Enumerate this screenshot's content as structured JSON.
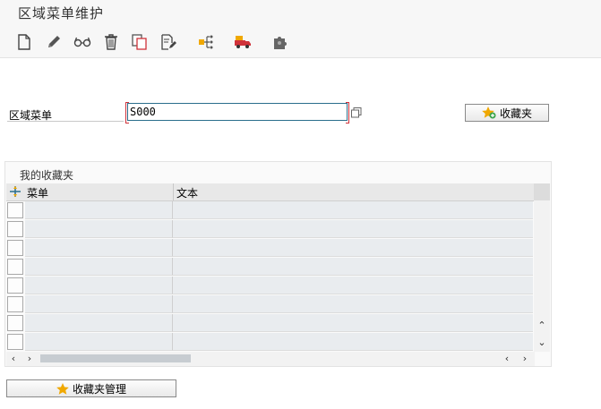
{
  "window": {
    "title": "区域菜单维护"
  },
  "toolbar": {
    "buttons": [
      {
        "name": "new-icon"
      },
      {
        "name": "edit-pencil-icon"
      },
      {
        "name": "display-glasses-icon"
      },
      {
        "name": "delete-trash-icon"
      },
      {
        "name": "copy-icon"
      },
      {
        "name": "document-edit-icon"
      },
      {
        "name": "hierarchy-icon"
      },
      {
        "name": "transport-truck-icon"
      },
      {
        "name": "puzzle-icon"
      }
    ]
  },
  "form": {
    "area_menu_label": "区域菜单",
    "area_menu_value": "S000",
    "favorites_button": "收藏夹"
  },
  "favorites_panel": {
    "title": "我的收藏夹",
    "columns": [
      "菜单",
      "文本"
    ],
    "rows": [
      [
        "",
        ""
      ],
      [
        "",
        ""
      ],
      [
        "",
        ""
      ],
      [
        "",
        ""
      ],
      [
        "",
        ""
      ],
      [
        "",
        ""
      ],
      [
        "",
        ""
      ],
      [
        "",
        ""
      ]
    ]
  },
  "footer": {
    "manage_favorites_button": "收藏夹管理"
  },
  "colors": {
    "input_border": "#2a6e8c",
    "required_mark": "#d0323a",
    "star": "#f0a800"
  }
}
